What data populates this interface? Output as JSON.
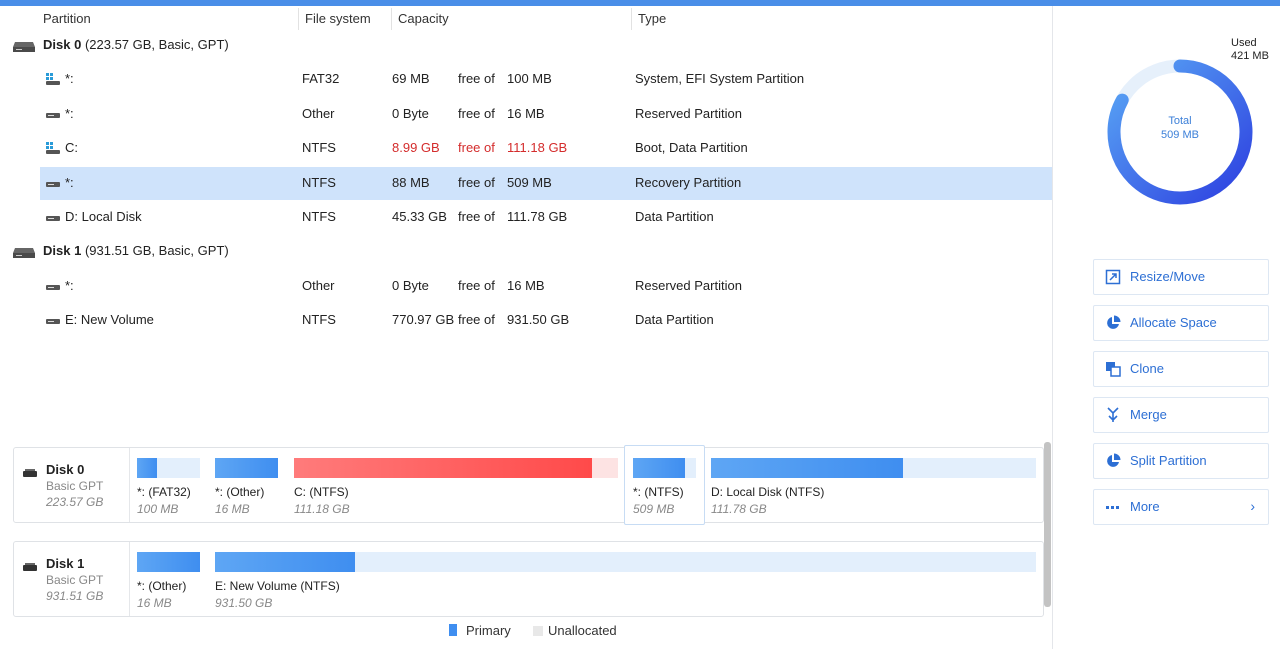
{
  "table": {
    "headers": {
      "partition": "Partition",
      "file_system": "File system",
      "capacity": "Capacity",
      "type": "Type"
    },
    "disks": [
      {
        "title": "Disk 0",
        "details": "(223.57 GB, Basic, GPT)",
        "partitions": [
          {
            "name": "*:",
            "icon": "windows-partition-icon",
            "fs": "FAT32",
            "free": "69 MB",
            "free_of": "free of",
            "total": "100 MB",
            "type": "System, EFI System Partition",
            "highlight": false,
            "warn": false
          },
          {
            "name": "*:",
            "icon": "drive-icon",
            "fs": "Other",
            "free": "0 Byte",
            "free_of": "free of",
            "total": "16 MB",
            "type": "Reserved Partition",
            "highlight": false,
            "warn": false
          },
          {
            "name": "C:",
            "icon": "windows-partition-icon",
            "fs": "NTFS",
            "free": "8.99 GB",
            "free_of": "free of",
            "total": "111.18 GB",
            "type": "Boot, Data Partition",
            "highlight": false,
            "warn": true
          },
          {
            "name": "*:",
            "icon": "drive-icon",
            "fs": "NTFS",
            "free": "88 MB",
            "free_of": "free of",
            "total": "509 MB",
            "type": "Recovery Partition",
            "highlight": true,
            "warn": false
          },
          {
            "name": "D: Local Disk",
            "icon": "drive-icon",
            "fs": "NTFS",
            "free": "45.33 GB",
            "free_of": "free of",
            "total": "111.78 GB",
            "type": "Data Partition",
            "highlight": false,
            "warn": false
          }
        ]
      },
      {
        "title": "Disk 1",
        "details": "(931.51 GB, Basic, GPT)",
        "partitions": [
          {
            "name": "*:",
            "icon": "drive-icon",
            "fs": "Other",
            "free": "0 Byte",
            "free_of": "free of",
            "total": "16 MB",
            "type": "Reserved Partition",
            "highlight": false,
            "warn": false
          },
          {
            "name": "E: New Volume",
            "icon": "drive-icon",
            "fs": "NTFS",
            "free": "770.97 GB",
            "free_of": "free of",
            "total": "931.50 GB",
            "type": "Data Partition",
            "highlight": false,
            "warn": false
          }
        ]
      }
    ]
  },
  "disk_map": [
    {
      "name": "Disk 0",
      "sub1": "Basic GPT",
      "sub2": "223.57 GB",
      "segments": [
        {
          "label": "*:  (FAT32)",
          "size": "100 MB",
          "used_fraction": 0.31,
          "color": "blue",
          "selected": false
        },
        {
          "label": "*:  (Other)",
          "size": "16 MB",
          "used_fraction": 1.0,
          "color": "blue",
          "selected": false
        },
        {
          "label": "C:  (NTFS)",
          "size": "111.18 GB",
          "used_fraction": 0.92,
          "color": "red",
          "selected": false
        },
        {
          "label": "*:  (NTFS)",
          "size": "509 MB",
          "used_fraction": 0.83,
          "color": "blue",
          "selected": true
        },
        {
          "label": "D: Local Disk (NTFS)",
          "size": "111.78 GB",
          "used_fraction": 0.59,
          "color": "blue",
          "selected": false
        }
      ]
    },
    {
      "name": "Disk 1",
      "sub1": "Basic GPT",
      "sub2": "931.51 GB",
      "segments": [
        {
          "label": "*:  (Other)",
          "size": "16 MB",
          "used_fraction": 1.0,
          "color": "blue",
          "selected": false
        },
        {
          "label": "E: New Volume (NTFS)",
          "size": "931.50 GB",
          "used_fraction": 0.17,
          "color": "blue",
          "selected": false
        }
      ]
    }
  ],
  "legend": {
    "primary": "Primary",
    "unallocated": "Unallocated"
  },
  "usage": {
    "used_label": "Used",
    "used_value": "421 MB",
    "total_label": "Total",
    "total_value": "509 MB",
    "used_fraction": 0.83
  },
  "actions": [
    {
      "label": "Resize/Move",
      "icon": "resize-icon"
    },
    {
      "label": "Allocate Space",
      "icon": "pie-chart-icon"
    },
    {
      "label": "Clone",
      "icon": "clone-icon"
    },
    {
      "label": "Merge",
      "icon": "merge-icon"
    },
    {
      "label": "Split Partition",
      "icon": "pie-chart-icon"
    },
    {
      "label": "More",
      "icon": "more-dots-icon",
      "has_chevron": true,
      "chevron": "›"
    }
  ],
  "colors": {
    "accent": "#2d6fd4",
    "primary_fill": "#3f8ef0",
    "primary_track": "#e3effc",
    "warn_fill": "#ff4a4a",
    "warn_track": "#fde3e3",
    "selection": "#cfe3fb",
    "warn_text": "#d42c2c"
  }
}
